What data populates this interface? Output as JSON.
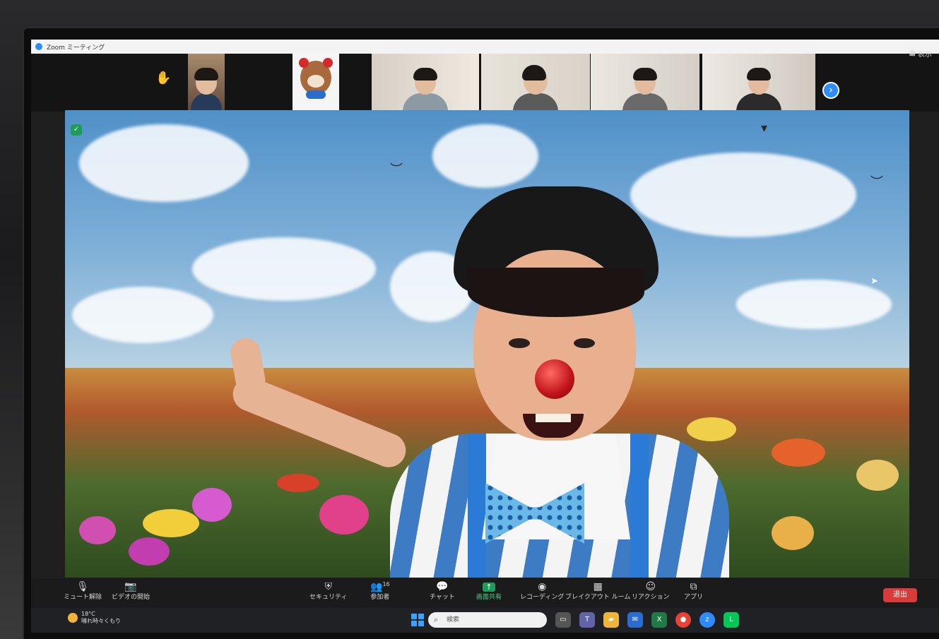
{
  "window": {
    "title": "Zoom ミーティング",
    "view_label": "表示"
  },
  "participants_strip": {
    "tiles": [
      "t1",
      "t2",
      "t3",
      "t4",
      "t5",
      "t6"
    ],
    "next_icon": "chevron-right-icon"
  },
  "toolbar": {
    "mute_label": "ミュート解除",
    "video_label": "ビデオの開始",
    "security_label": "セキュリティ",
    "participants_label": "参加者",
    "participants_count": "16",
    "chat_label": "チャット",
    "share_label": "画面共有",
    "record_label": "レコーディング",
    "breakout_label": "ブレイクアウト ルーム",
    "reactions_label": "リアクション",
    "apps_label": "アプリ",
    "leave_label": "退出"
  },
  "taskbar": {
    "weather_temp": "18°C",
    "weather_text": "晴れ時々くもり",
    "search_placeholder": "検索",
    "apps": [
      "file-explorer",
      "teams",
      "folder",
      "mail",
      "excel",
      "chrome",
      "zoom",
      "line"
    ]
  },
  "colors": {
    "accent": "#2d8cff",
    "leave": "#d93a3a",
    "share": "#1e9d5a"
  }
}
